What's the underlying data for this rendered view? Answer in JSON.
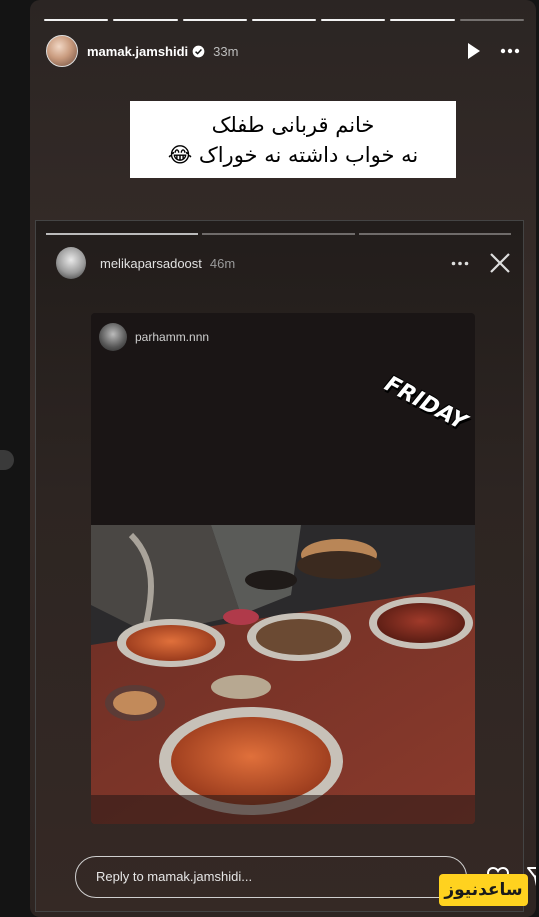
{
  "story": {
    "progress_segments": 7,
    "header": {
      "username": "mamak.jamshidi",
      "time": "33m",
      "verified": true,
      "icons": [
        "play-icon",
        "more-icon"
      ]
    },
    "caption": {
      "line1": "خانم قربانی طفلک",
      "line2": "نه خواب داشته نه خوراک 😂"
    }
  },
  "inner_story": {
    "username": "melikaparsadoost",
    "time": "46m",
    "icons": [
      "more-icon",
      "close-icon"
    ]
  },
  "nested_story": {
    "username": "parhamm.nnn",
    "sticker": "FRIDAY"
  },
  "footer": {
    "reply_placeholder": "Reply to mamak.jamshidi...",
    "icons": [
      "heart-icon",
      "send-icon"
    ]
  },
  "watermark": {
    "text": "ساعدنیوز",
    "color": "#ffd21f"
  }
}
